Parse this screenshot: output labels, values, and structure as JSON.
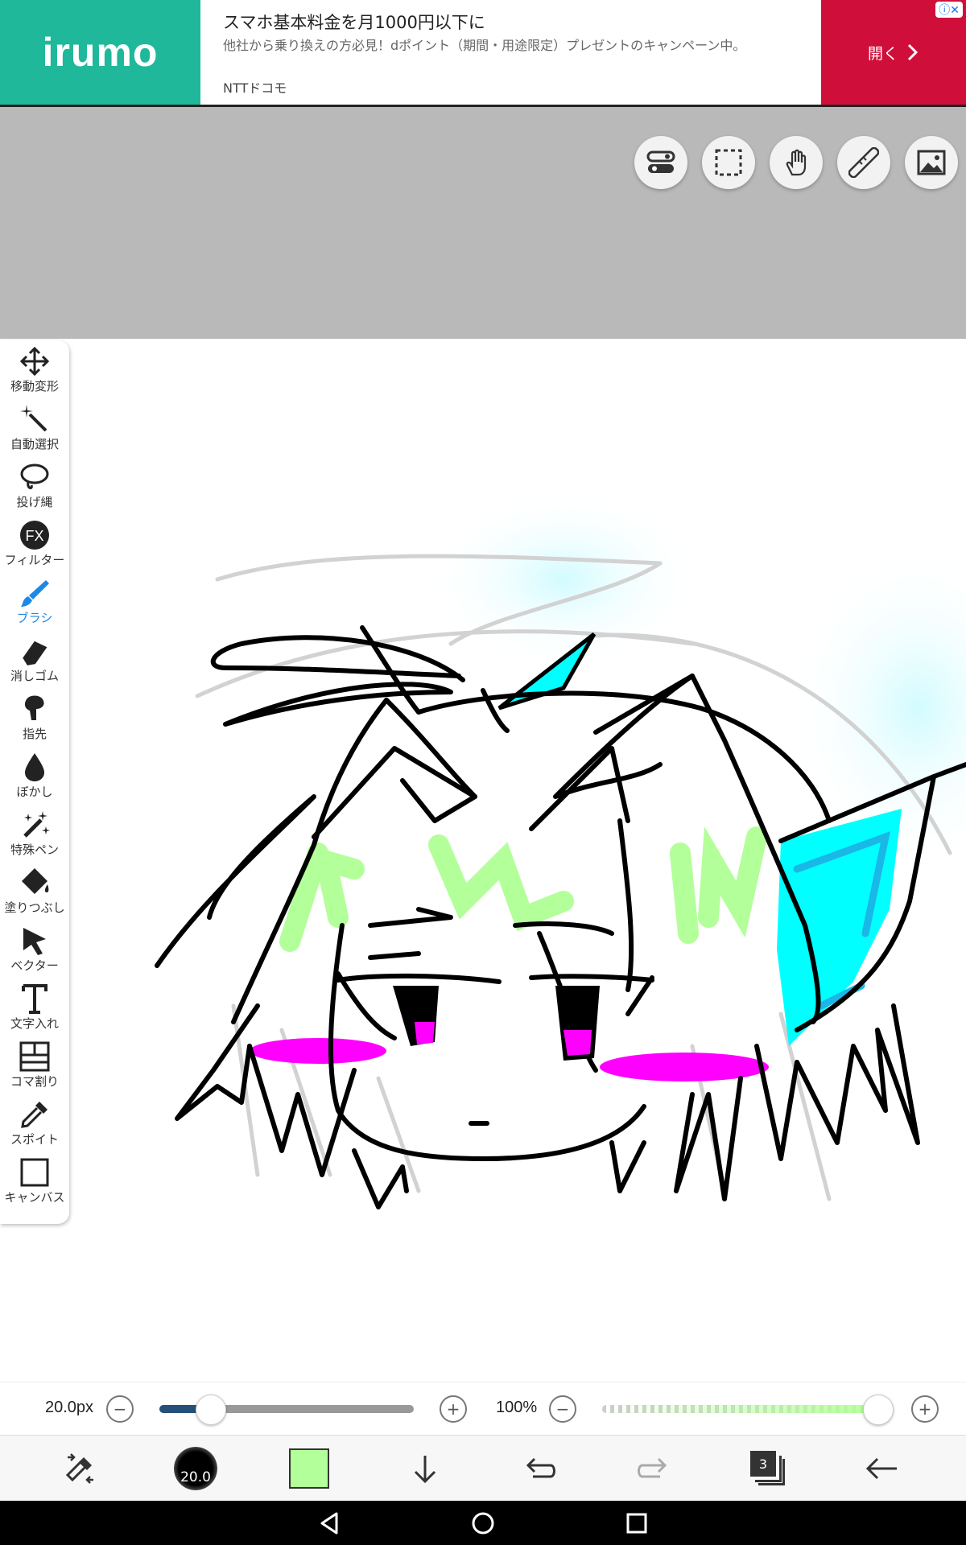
{
  "ad": {
    "logo": "irumo",
    "title": "スマホ基本料金を月1000円以下に",
    "description": "他社から乗り換えの方必見！dポイント（期間・用途限定）プレゼントのキャンペーン中。",
    "brand": "NTTドコモ",
    "open_label": "開く",
    "info": "ⓘ✕"
  },
  "top_tools": [
    "toggle-icon",
    "selection-icon",
    "hand-icon",
    "ruler-icon",
    "image-icon"
  ],
  "sidebar": {
    "items": [
      {
        "label": "移動変形",
        "icon": "move-icon"
      },
      {
        "label": "自動選択",
        "icon": "magic-wand-icon"
      },
      {
        "label": "投げ縄",
        "icon": "lasso-icon"
      },
      {
        "label": "フィルター",
        "icon": "fx-icon"
      },
      {
        "label": "ブラシ",
        "icon": "brush-icon"
      },
      {
        "label": "消しゴム",
        "icon": "eraser-icon"
      },
      {
        "label": "指先",
        "icon": "finger-icon"
      },
      {
        "label": "ぼかし",
        "icon": "blur-icon"
      },
      {
        "label": "特殊ペン",
        "icon": "special-pen-icon"
      },
      {
        "label": "塗りつぶし",
        "icon": "fill-icon"
      },
      {
        "label": "ベクター",
        "icon": "vector-icon"
      },
      {
        "label": "文字入れ",
        "icon": "text-icon"
      },
      {
        "label": "コマ割り",
        "icon": "panel-icon"
      },
      {
        "label": "スポイト",
        "icon": "eyedropper-icon"
      },
      {
        "label": "キャンバス",
        "icon": "canvas-icon"
      }
    ],
    "active": "ブラシ"
  },
  "sliders": {
    "size_label": "20.0px",
    "size_value": 0.2,
    "opacity_label": "100%",
    "opacity_value": 1.0,
    "minus": "−",
    "plus": "+"
  },
  "bottom_bar": {
    "brush_size": "20.0",
    "color": "#b3ff99",
    "layer_count": "3"
  },
  "colors": {
    "accent": "#1e88e5",
    "ad_green": "#1fb89a",
    "ad_red": "#cf0f3a",
    "hair_highlight": "#b3ff99",
    "cyan": "#00ffff",
    "blush": "#ff00ff"
  }
}
